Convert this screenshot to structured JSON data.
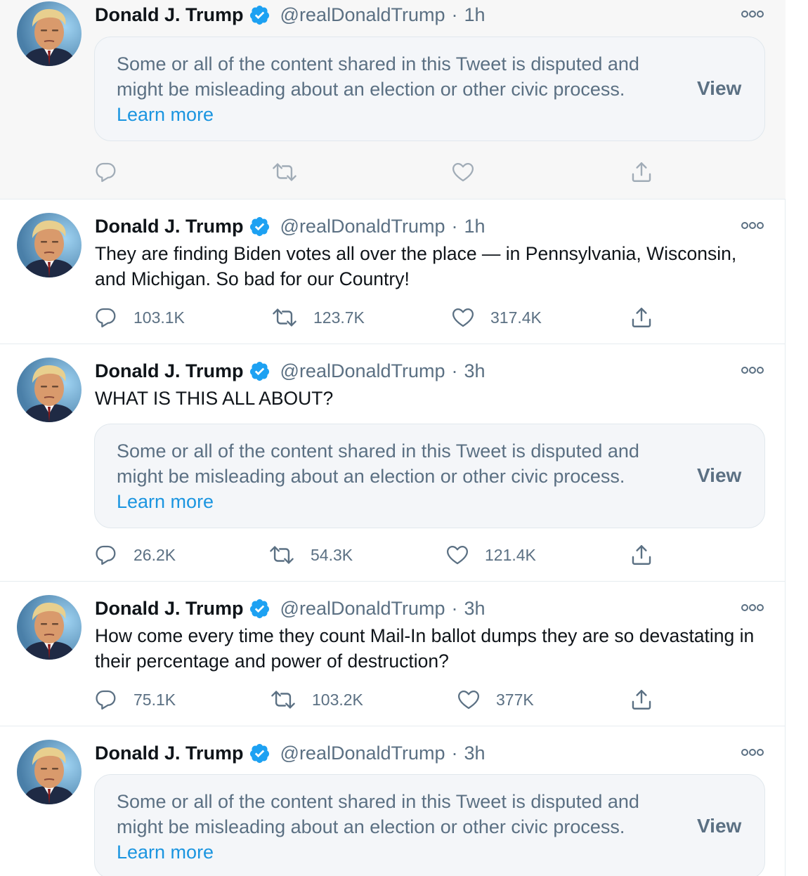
{
  "author": {
    "name": "Donald J. Trump",
    "handle": "@realDonaldTrump",
    "separator": "·"
  },
  "notice": {
    "text": "Some or all of the content shared in this Tweet is disputed and might be misleading about an election or other civic process.",
    "learn_more": "Learn more",
    "view": "View"
  },
  "icons": {
    "verified": "verified-badge-icon",
    "more": "more-options-icon",
    "reply": "reply-icon",
    "retweet": "retweet-icon",
    "like": "like-icon",
    "share": "share-icon"
  },
  "colors": {
    "verified": "#1da1f2",
    "link": "#1b95e0",
    "secondary": "#5b7083"
  },
  "tweets": [
    {
      "time": "1h",
      "text": "",
      "replies": "",
      "retweets": "",
      "likes": ""
    },
    {
      "time": "1h",
      "text": "They are finding Biden votes all over the place — in Pennsylvania, Wisconsin, and Michigan. So bad for our Country!",
      "replies": "103.1K",
      "retweets": "123.7K",
      "likes": "317.4K"
    },
    {
      "time": "3h",
      "text": "WHAT IS THIS ALL ABOUT?",
      "replies": "26.2K",
      "retweets": "54.3K",
      "likes": "121.4K"
    },
    {
      "time": "3h",
      "text": "How come every time they count Mail-In ballot dumps they are so devastating in their percentage and power of destruction?",
      "replies": "75.1K",
      "retweets": "103.2K",
      "likes": "377K"
    },
    {
      "time": "3h",
      "text": "",
      "replies": "",
      "retweets": "",
      "likes": ""
    }
  ]
}
